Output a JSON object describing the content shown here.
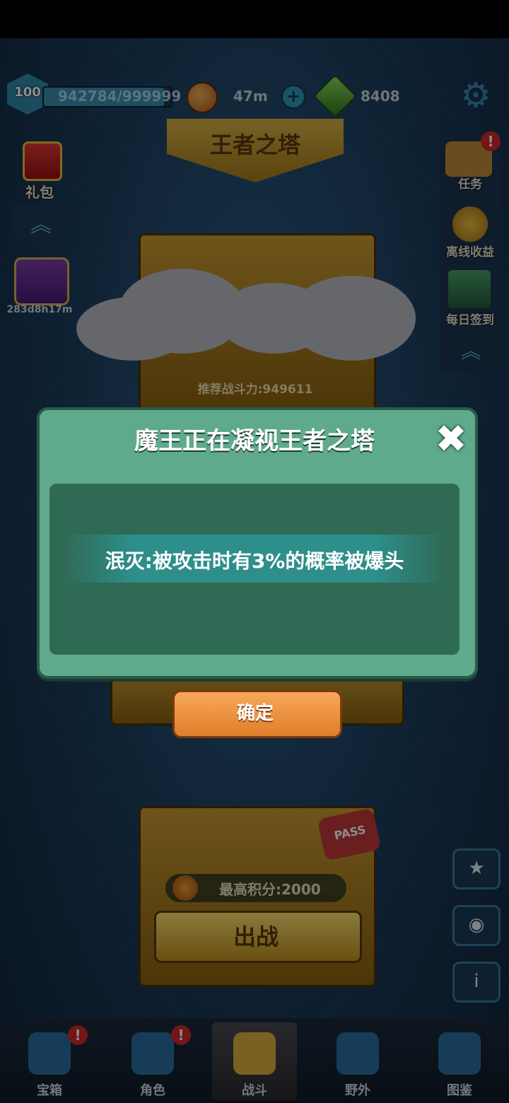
{
  "status": {
    "level": "100",
    "xp": "942784/999999",
    "xp_progress": 0.943,
    "energy_timer": "47m",
    "gems": "8408"
  },
  "tower_title": "王者之塔",
  "left": {
    "gift_label": "礼包",
    "timer_label": "283d8h17m"
  },
  "right": {
    "quest_label": "任务",
    "quest_badge": "!",
    "offline_label": "离线收益",
    "daily_label": "每日签到"
  },
  "tower": {
    "recommended_power": "推荐战斗力:949611",
    "high_score": "最高积分:2000",
    "fight_label": "出战",
    "pass_label": "PASS"
  },
  "dialog": {
    "title": "魔王正在凝视王者之塔",
    "close_symbol": "✖",
    "effect": "泯灭:被攻击时有3%的概率被爆头",
    "confirm_label": "确定"
  },
  "nav": {
    "items": [
      {
        "label": "宝箱",
        "badge": "!"
      },
      {
        "label": "角色",
        "badge": "!"
      },
      {
        "label": "战斗"
      },
      {
        "label": "野外"
      },
      {
        "label": "图鉴"
      }
    ]
  },
  "colors": {
    "dialog_bg": "#5faa8c",
    "dialog_inner": "#2f6a55",
    "confirm": "#f0923e",
    "badge_red": "#d02828"
  },
  "icons": [
    "gear-icon",
    "plus-icon",
    "gem-icon",
    "coin-icon",
    "close-icon",
    "medal-icon",
    "eye-icon",
    "info-icon"
  ]
}
